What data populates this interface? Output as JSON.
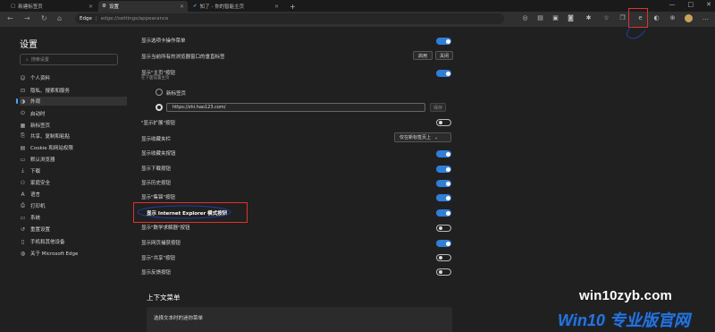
{
  "tabs": [
    {
      "label": "新建标签页",
      "icon": "page-icon"
    },
    {
      "label": "设置",
      "icon": "gear-icon"
    },
    {
      "label": "知了 - 你的智能主页",
      "icon": "check-icon"
    }
  ],
  "new_tab_symbol": "+",
  "window_controls": [
    "—",
    "□",
    "✕"
  ],
  "address_bar": {
    "badge": "Edge",
    "url": "edge://settings/appearance"
  },
  "sidebar": {
    "title": "设置",
    "search_placeholder": "搜索设置",
    "items": [
      {
        "label": "个人资料",
        "icon": "person-icon"
      },
      {
        "label": "隐私、搜索和服务",
        "icon": "lock-icon"
      },
      {
        "label": "外观",
        "icon": "appearance-icon"
      },
      {
        "label": "启动时",
        "icon": "power-icon"
      },
      {
        "label": "新标签页",
        "icon": "newtab-icon"
      },
      {
        "label": "共享、复制和粘贴",
        "icon": "share-icon"
      },
      {
        "label": "Cookie 和网站权限",
        "icon": "cookie-icon"
      },
      {
        "label": "默认浏览器",
        "icon": "browser-icon"
      },
      {
        "label": "下载",
        "icon": "download-icon"
      },
      {
        "label": "家庭安全",
        "icon": "family-icon"
      },
      {
        "label": "语言",
        "icon": "language-icon"
      },
      {
        "label": "打印机",
        "icon": "printer-icon"
      },
      {
        "label": "系统",
        "icon": "system-icon"
      },
      {
        "label": "重置设置",
        "icon": "reset-icon"
      },
      {
        "label": "手机和其他设备",
        "icon": "phone-icon"
      },
      {
        "label": "关于 Microsoft Edge",
        "icon": "edge-icon"
      }
    ]
  },
  "settings": {
    "tab_actions_menu": "显示选项卡操作菜单",
    "restore_tabs": "显示当前所有的浏览器窗口的垂直标签",
    "apply_label": "启用",
    "close_label": "关闭",
    "home_button": "显示\"主页\"按钮",
    "home_sub": "在下面设置主页",
    "new_tab_page": "新标签页",
    "home_url": "https://zhi.hao123.com/",
    "save_label": "保存",
    "extensions_button": "\"显示扩展\"按钮",
    "favorites_bar": "显示收藏夹栏",
    "favorites_bar_value": "仅在新标签页上",
    "favorites_button": "显示收藏夹按钮",
    "downloads_button": "显示下载按钮",
    "history_button": "显示历史按钮",
    "collections_button": "显示\"集锦\"按钮",
    "ie_mode_button": "显示 Internet Explorer 模式按钮",
    "math_solver_button": "显示\"数学求解器\"按钮",
    "web_capture_button": "显示网页捕获按钮",
    "share_button": "显示\"共享\"按钮",
    "feedback_button": "显示反馈按钮",
    "context_menu_title": "上下文菜单",
    "mini_menu_label": "选择文本时的迷你菜单"
  },
  "watermark": {
    "line1": "win10zyb.com",
    "line2": "Win10 专业版官网"
  },
  "colors": {
    "accent": "#2f7fd8",
    "highlight": "#e2312d",
    "background": "#202020"
  }
}
